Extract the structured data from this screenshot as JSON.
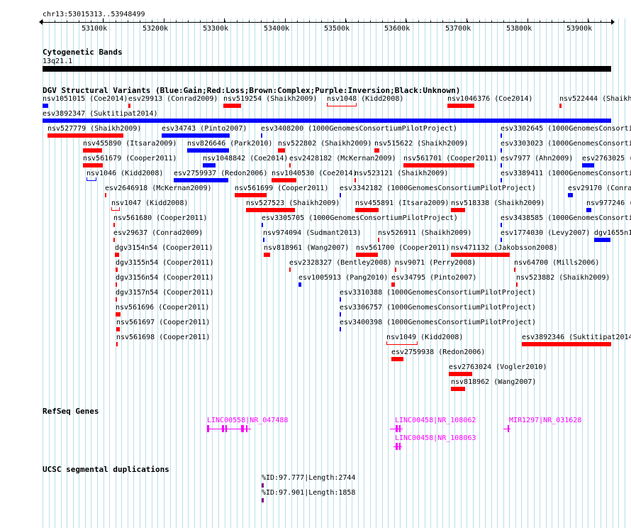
{
  "ruler": {
    "region": "chr13:53015313..53948499",
    "ticks": [
      "53100k",
      "53200k",
      "53300k",
      "53400k",
      "53500k",
      "53600k",
      "53700k",
      "53800k",
      "53900k"
    ]
  },
  "tracks": {
    "cytoband": {
      "title": "Cytogenetic Bands",
      "band": "13q21.1"
    },
    "dgv": {
      "title": "DGV Structural Variants (Blue:Gain;Red:Loss;Brown:Complex;Purple:Inversion;Black:Unknown)",
      "colors": {
        "gain": "#0000ff",
        "loss": "#ff0000",
        "complex": "#8b4513",
        "inversion": "#800080",
        "unknown": "#000000"
      },
      "features": [
        {
          "label": "nsv1051015 (Coe2014)",
          "type": "gain"
        },
        {
          "label": "esv29913 (Conrad2009)",
          "type": "loss"
        },
        {
          "label": "nsv519254 (Shaikh2009)",
          "type": "loss"
        },
        {
          "label": "nsv1048 (Kidd2008)",
          "type": "loss"
        },
        {
          "label": "nsv1046376 (Coe2014)",
          "type": "loss"
        },
        {
          "label": "nsv522444 (Shaikh",
          "type": "loss"
        },
        {
          "label": "esv3892347 (Suktitipat2014)",
          "type": "gain"
        },
        {
          "label": "nsv527779 (Shaikh2009)",
          "type": "loss"
        },
        {
          "label": "esv34743 (Pinto2007)",
          "type": "gain"
        },
        {
          "label": "esv3408200 (1000GenomesConsortiumPilotProject)",
          "type": "gain"
        },
        {
          "label": "esv3302645 (1000GenomesConsorti",
          "type": "gain"
        },
        {
          "label": "nsv455890 (Itsara2009)",
          "type": "loss"
        },
        {
          "label": "nsv826646 (Park2010)",
          "type": "gain"
        },
        {
          "label": "nsv522802 (Shaikh2009)",
          "type": "loss"
        },
        {
          "label": "nsv515622 (Shaikh2009)",
          "type": "loss"
        },
        {
          "label": "esv3303023 (1000GenomesConsorti",
          "type": "gain"
        },
        {
          "label": "nsv561679 (Cooper2011)",
          "type": "loss"
        },
        {
          "label": "nsv1048842 (Coe2014)",
          "type": "gain"
        },
        {
          "label": "esv2428182 (McKernan2009)",
          "type": "loss"
        },
        {
          "label": "nsv561701 (Cooper2011)",
          "type": "loss"
        },
        {
          "label": "esv7977 (Ahn2009)",
          "type": "gain"
        },
        {
          "label": "esv2763025 (",
          "type": "gain"
        },
        {
          "label": "nsv1046 (Kidd2008)",
          "type": "gain"
        },
        {
          "label": "esv2759937 (Redon2006)",
          "type": "gain"
        },
        {
          "label": "nsv1040530 (Coe2014)",
          "type": "loss"
        },
        {
          "label": "nsv523121 (Shaikh2009)",
          "type": "loss"
        },
        {
          "label": "esv3389411 (1000GenomesConsorti",
          "type": "gain"
        },
        {
          "label": "esv2646918 (McKernan2009)",
          "type": "loss"
        },
        {
          "label": "nsv561699 (Cooper2011)",
          "type": "loss"
        },
        {
          "label": "esv3342182 (1000GenomesConsortiumPilotProject)",
          "type": "gain"
        },
        {
          "label": "esv29170 (Conra",
          "type": "gain"
        },
        {
          "label": "nsv1047 (Kidd2008)",
          "type": "loss"
        },
        {
          "label": "nsv527523 (Shaikh2009)",
          "type": "loss"
        },
        {
          "label": "nsv455891 (Itsara2009)",
          "type": "loss"
        },
        {
          "label": "nsv518338 (Shaikh2009)",
          "type": "loss"
        },
        {
          "label": "nsv977246 (",
          "type": "gain"
        },
        {
          "label": "nsv561680 (Cooper2011)",
          "type": "loss"
        },
        {
          "label": "esv3305705 (1000GenomesConsortiumPilotProject)",
          "type": "gain"
        },
        {
          "label": "esv3438585 (1000GenomesConsorti",
          "type": "gain"
        },
        {
          "label": "esv29637 (Conrad2009)",
          "type": "loss"
        },
        {
          "label": "nsv974094 (Sudmant2013)",
          "type": "gain"
        },
        {
          "label": "nsv526911 (Shaikh2009)",
          "type": "loss"
        },
        {
          "label": "esv1774030 (Levy2007)",
          "type": "gain"
        },
        {
          "label": "dgv1655n1",
          "type": "gain"
        },
        {
          "label": "dgv3154n54 (Cooper2011)",
          "type": "loss"
        },
        {
          "label": "nsv818961 (Wang2007)",
          "type": "loss"
        },
        {
          "label": "nsv561700 (Cooper2011)",
          "type": "loss"
        },
        {
          "label": "nsv471132 (Jakobsson2008)",
          "type": "loss"
        },
        {
          "label": "dgv3155n54 (Cooper2011)",
          "type": "loss"
        },
        {
          "label": "esv2328327 (Bentley2008)",
          "type": "loss"
        },
        {
          "label": "nsv9071 (Perry2008)",
          "type": "loss"
        },
        {
          "label": "nsv64700 (Mills2006)",
          "type": "loss"
        },
        {
          "label": "dgv3156n54 (Cooper2011)",
          "type": "loss"
        },
        {
          "label": "esv1005913 (Pang2010)",
          "type": "gain"
        },
        {
          "label": "esv34795 (Pinto2007)",
          "type": "loss"
        },
        {
          "label": "nsv523882 (Shaikh2009)",
          "type": "loss"
        },
        {
          "label": "dgv3157n54 (Cooper2011)",
          "type": "loss"
        },
        {
          "label": "esv3310388 (1000GenomesConsortiumPilotProject)",
          "type": "gain"
        },
        {
          "label": "nsv561696 (Cooper2011)",
          "type": "loss"
        },
        {
          "label": "esv3306757 (1000GenomesConsortiumPilotProject)",
          "type": "gain"
        },
        {
          "label": "nsv561697 (Cooper2011)",
          "type": "loss"
        },
        {
          "label": "esv3400398 (1000GenomesConsortiumPilotProject)",
          "type": "gain"
        },
        {
          "label": "nsv561698 (Cooper2011)",
          "type": "loss"
        },
        {
          "label": "nsv1049 (Kidd2008)",
          "type": "loss"
        },
        {
          "label": "esv3892346 (Suktitipat2014",
          "type": "loss"
        },
        {
          "label": "esv2759938 (Redon2006)",
          "type": "loss"
        },
        {
          "label": "esv2763024 (Vogler2010)",
          "type": "loss"
        },
        {
          "label": "nsv818962 (Wang2007)",
          "type": "loss"
        }
      ]
    },
    "refseq": {
      "title": "RefSeq Genes",
      "color": "#ff00ff",
      "genes": [
        {
          "label": "LINC00558|NR_047488"
        },
        {
          "label": "LINC00458|NR_108062"
        },
        {
          "label": "LINC00458|NR_108063"
        },
        {
          "label": "MIR1297|NR_031628"
        }
      ]
    },
    "segdups": {
      "title": "UCSC segmental duplications",
      "color": "#800080",
      "items": [
        {
          "label": "%ID:97.777|Length:2744"
        },
        {
          "label": "%ID:97.901|Length:1858"
        }
      ]
    }
  }
}
